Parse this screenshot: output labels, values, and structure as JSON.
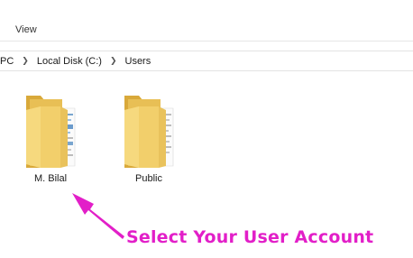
{
  "ribbon": {
    "view_tab": "View"
  },
  "breadcrumb": {
    "items": [
      "PC",
      "Local Disk (C:)",
      "Users"
    ],
    "separator_icon": "chevron-right-icon"
  },
  "folders": [
    {
      "name": "M. Bilal",
      "icon": "folder-icon"
    },
    {
      "name": "Public",
      "icon": "folder-icon"
    }
  ],
  "annotation": {
    "text": "Select Your User Account",
    "color": "#e21fc8",
    "arrow_icon": "arrow-icon"
  }
}
